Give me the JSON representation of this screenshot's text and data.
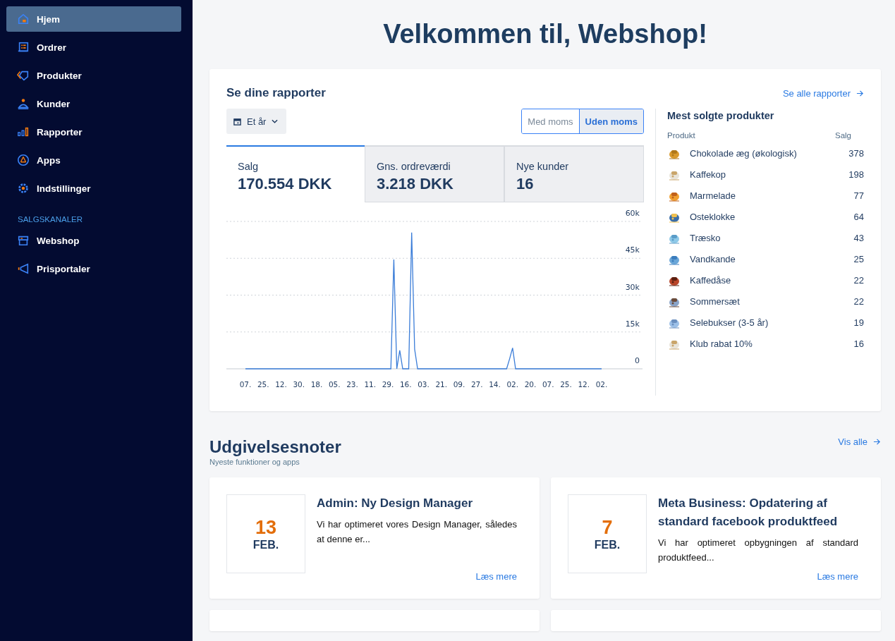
{
  "sidebar": {
    "items": [
      {
        "label": "Hjem",
        "selected": true
      },
      {
        "label": "Ordrer",
        "selected": false
      },
      {
        "label": "Produkter",
        "selected": false
      },
      {
        "label": "Kunder",
        "selected": false
      },
      {
        "label": "Rapporter",
        "selected": false
      },
      {
        "label": "Apps",
        "selected": false
      },
      {
        "label": "Indstillinger",
        "selected": false
      }
    ],
    "section_title": "SALGSKANALER",
    "channels": [
      {
        "label": "Webshop",
        "selected": false
      },
      {
        "label": "Prisportaler",
        "selected": false
      }
    ]
  },
  "page_title": "Velkommen til, Webshop!",
  "reports": {
    "title": "Se dine rapporter",
    "link": "Se alle rapporter",
    "period": "Et år",
    "vat_toggle": [
      {
        "label": "Med moms",
        "selected": false
      },
      {
        "label": "Uden moms",
        "selected": true
      }
    ],
    "metrics": [
      {
        "label": "Salg",
        "value": "170.554 DKK",
        "selected": true
      },
      {
        "label": "Gns. ordreværdi",
        "value": "3.218 DKK",
        "selected": false
      },
      {
        "label": "Nye kunder",
        "value": "16",
        "selected": false
      }
    ],
    "chart_data": {
      "type": "line",
      "categories": [
        "07.",
        null,
        null,
        null,
        null,
        null,
        "25.",
        null,
        null,
        null,
        null,
        null,
        "12.",
        null,
        null,
        null,
        null,
        null,
        "30.",
        null,
        null,
        null,
        null,
        null,
        "18.",
        null,
        null,
        null,
        null,
        null,
        "05.",
        null,
        null,
        null,
        null,
        null,
        "23.",
        null,
        null,
        null,
        null,
        null,
        "11.",
        null,
        null,
        null,
        null,
        null,
        "29.",
        null,
        null,
        null,
        null,
        null,
        "16.",
        null,
        null,
        null,
        null,
        null,
        "03.",
        null,
        null,
        null,
        null,
        null,
        "21.",
        null,
        null,
        null,
        null,
        null,
        "09.",
        null,
        null,
        null,
        null,
        null,
        "27.",
        null,
        null,
        null,
        null,
        null,
        "14.",
        null,
        null,
        null,
        null,
        null,
        "02.",
        null,
        null,
        null,
        null,
        null,
        "20.",
        null,
        null,
        null,
        null,
        null,
        "07.",
        null,
        null,
        null,
        null,
        null,
        "25.",
        null,
        null,
        null,
        null,
        null,
        "12.",
        null,
        null,
        null,
        null,
        null,
        "02."
      ],
      "series": [
        {
          "color": "#3b7dd8",
          "values": [
            0,
            0,
            0,
            0,
            0,
            0,
            0,
            0,
            0,
            0,
            0,
            0,
            0,
            0,
            0,
            0,
            0,
            0,
            0,
            0,
            0,
            0,
            0,
            0,
            0,
            0,
            0,
            0,
            0,
            0,
            0,
            0,
            0,
            0,
            0,
            0,
            0,
            0,
            0,
            0,
            0,
            0,
            0,
            0,
            0,
            0,
            0,
            0,
            0,
            0,
            44500,
            0,
            7500,
            0,
            0,
            0,
            55500,
            8000,
            0,
            0,
            0,
            0,
            0,
            0,
            0,
            0,
            0,
            0,
            0,
            0,
            0,
            0,
            0,
            0,
            0,
            0,
            0,
            0,
            0,
            0,
            0,
            0,
            0,
            0,
            0,
            0,
            0,
            0,
            0,
            4000,
            8500,
            0,
            0,
            0,
            0,
            0,
            0,
            0,
            0,
            0,
            0,
            0,
            0,
            0,
            0,
            0,
            0,
            0,
            0,
            0,
            0,
            0,
            0,
            0,
            0,
            0,
            0,
            0,
            0,
            0,
            0
          ]
        }
      ],
      "ylim": [
        0,
        60000
      ],
      "grid": true,
      "yticks": [
        {
          "value": 0,
          "label": "0"
        },
        {
          "value": 15000,
          "label": "15k"
        },
        {
          "value": 30000,
          "label": "30k"
        },
        {
          "value": 45000,
          "label": "45k"
        },
        {
          "value": 60000,
          "label": "60k"
        }
      ]
    },
    "top_products": {
      "title": "Mest solgte produkter",
      "columns": [
        "Produkt",
        "Salg"
      ],
      "rows": [
        {
          "name": "Chokolade æg (økologisk)",
          "sales": "378"
        },
        {
          "name": "Kaffekop",
          "sales": "198"
        },
        {
          "name": "Marmelade",
          "sales": "77"
        },
        {
          "name": "Osteklokke",
          "sales": "64"
        },
        {
          "name": "Træsko",
          "sales": "43"
        },
        {
          "name": "Vandkande",
          "sales": "25"
        },
        {
          "name": "Kaffedåse",
          "sales": "22"
        },
        {
          "name": "Sommersæt",
          "sales": "22"
        },
        {
          "name": "Selebukser (3-5 år)",
          "sales": "19"
        },
        {
          "name": "Klub rabat 10%",
          "sales": "16"
        }
      ]
    }
  },
  "release_notes": {
    "title": "Udgivelsesnoter",
    "subtitle": "Nyeste funktioner og apps",
    "link": "Vis alle",
    "notes": [
      {
        "day": "13",
        "month": "FEB.",
        "title": "Admin: Ny Design Manager",
        "text": "Vi har optimeret vores Design Manager, således at denne er...",
        "link": "Læs mere"
      },
      {
        "day": "7",
        "month": "FEB.",
        "title": "Meta Business: Opdatering af standard facebook produktfeed",
        "text": "Vi har optimeret opbygningen af standard produktfeed...",
        "link": "Læs mere"
      }
    ]
  }
}
